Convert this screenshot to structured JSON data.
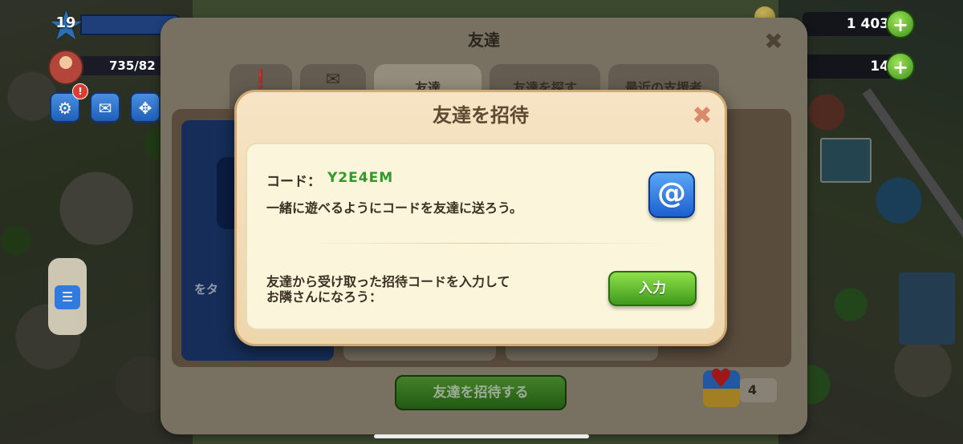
{
  "hud": {
    "level": "19",
    "population": "735/82",
    "notification_badge": "!",
    "resources": [
      {
        "name": "coins",
        "value": "1 403"
      },
      {
        "name": "banknotes",
        "value": "14"
      }
    ]
  },
  "friends_panel": {
    "title": "友達",
    "tabs": [
      {
        "label": "",
        "icon": "alert-icon"
      },
      {
        "label": "",
        "icon": "mail-icon"
      },
      {
        "label": "友達",
        "icon": ""
      },
      {
        "label": "友達を探す",
        "icon": ""
      },
      {
        "label": "最近の支援者",
        "icon": ""
      }
    ],
    "card_text": "をタ",
    "invite_button": "友達を招待する",
    "gift_count": "4"
  },
  "invite_modal": {
    "title": "友達を招待",
    "code_label": "コード：",
    "code_value": "Y2E4EM",
    "code_description": "一緒に遊べるようにコードを友達に送ろう。",
    "share_icon": "@",
    "enter_description_line1": "友達から受け取った招待コードを入力して",
    "enter_description_line2": "お隣さんになろう：",
    "enter_button": "入力"
  },
  "colors": {
    "accent_green": "#3f9a1c",
    "code_green": "#2f9a2a",
    "share_blue": "#1c5fcf",
    "modal_bg": "#f6e4c4"
  }
}
